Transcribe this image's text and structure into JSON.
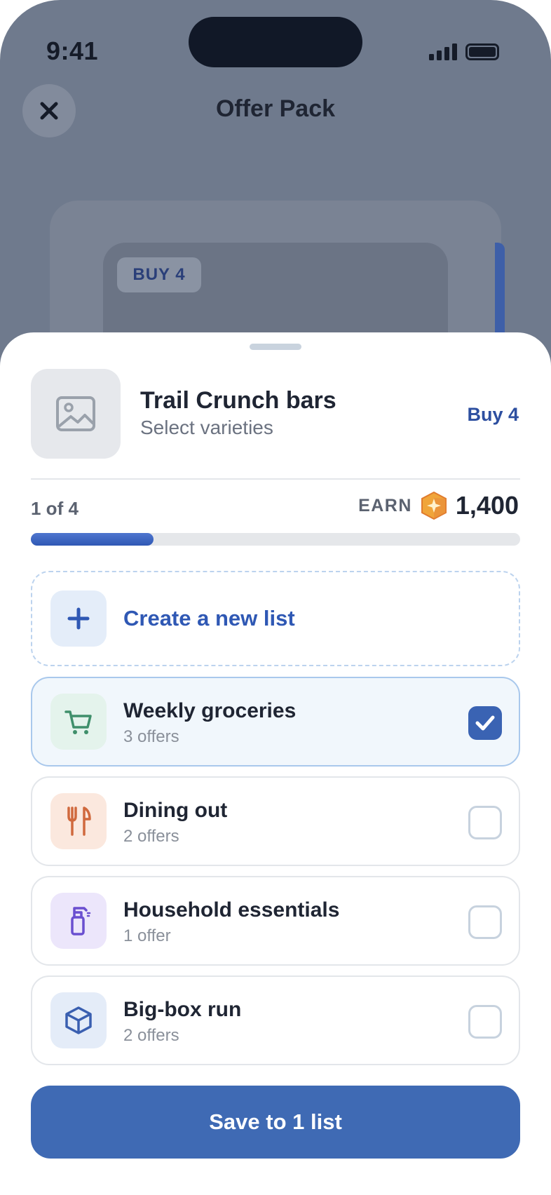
{
  "status_bar": {
    "time": "9:41"
  },
  "header": {
    "title": "Offer Pack",
    "close_icon": "close-icon"
  },
  "background_card": {
    "chip_label": "BUY 4"
  },
  "product": {
    "title": "Trail Crunch bars",
    "subtitle": "Select varieties",
    "buy_label": "Buy 4",
    "thumbnail_icon": "image-placeholder-icon"
  },
  "progress": {
    "label": "1 of 4",
    "fraction": 0.25
  },
  "earn": {
    "label": "EARN",
    "points": "1,400",
    "badge_icon": "points-badge-icon"
  },
  "create_list": {
    "label": "Create a new list",
    "icon": "plus-icon"
  },
  "lists": [
    {
      "name": "Weekly groceries",
      "count": "3 offers",
      "icon": "cart-icon",
      "checked": true,
      "icon_bg": "#e4f3ec",
      "icon_color": "#3f8f6b"
    },
    {
      "name": "Dining out",
      "count": "2 offers",
      "icon": "utensils-icon",
      "checked": false,
      "icon_bg": "#fbe8de",
      "icon_color": "#d0693d"
    },
    {
      "name": "Household essentials",
      "count": "1 offer",
      "icon": "spray-bottle-icon",
      "checked": false,
      "icon_bg": "#ece6fb",
      "icon_color": "#6a4fd0"
    },
    {
      "name": "Big-box run",
      "count": "2 offers",
      "icon": "box-icon",
      "checked": false,
      "icon_bg": "#e4ecf8",
      "icon_color": "#3a5fb0"
    }
  ],
  "save_button": {
    "label": "Save to 1 list"
  },
  "colors": {
    "accent": "#3f6ab4",
    "link": "#2f58b4",
    "backdrop": "#6f7a8d"
  }
}
